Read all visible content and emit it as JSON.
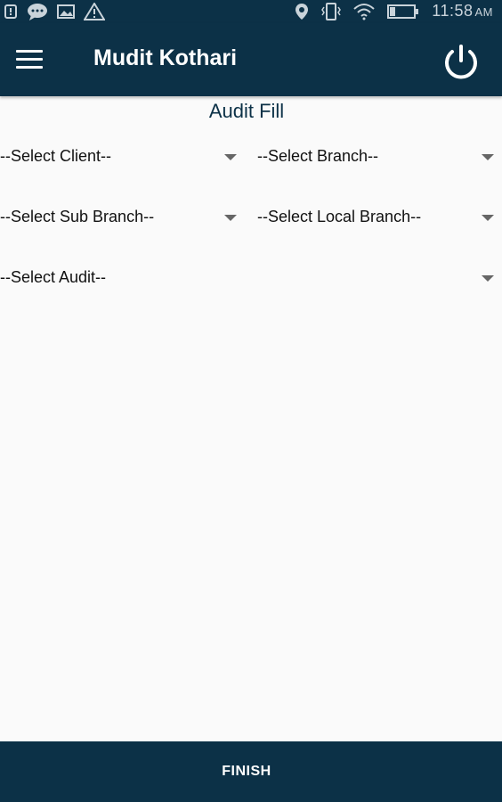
{
  "status_bar": {
    "time": "11:58",
    "ampm": "AM",
    "icons": [
      "notification-icon",
      "chat-icon",
      "image-icon",
      "warning-icon",
      "location-icon",
      "vibrate-icon",
      "wifi-icon",
      "battery-icon"
    ]
  },
  "app_bar": {
    "title": "Mudit Kothari",
    "menu_icon": "hamburger-menu-icon",
    "power_icon": "power-icon"
  },
  "page": {
    "heading": "Audit Fill"
  },
  "dropdowns": {
    "client": "--Select Client--",
    "branch": "--Select Branch--",
    "sub_branch": "--Select Sub Branch--",
    "local_branch": "--Select Local Branch--",
    "audit": "--Select Audit--"
  },
  "footer": {
    "finish_label": "FINISH"
  },
  "colors": {
    "primary": "#0c3147",
    "background": "#fafafa",
    "caret": "#666666"
  }
}
